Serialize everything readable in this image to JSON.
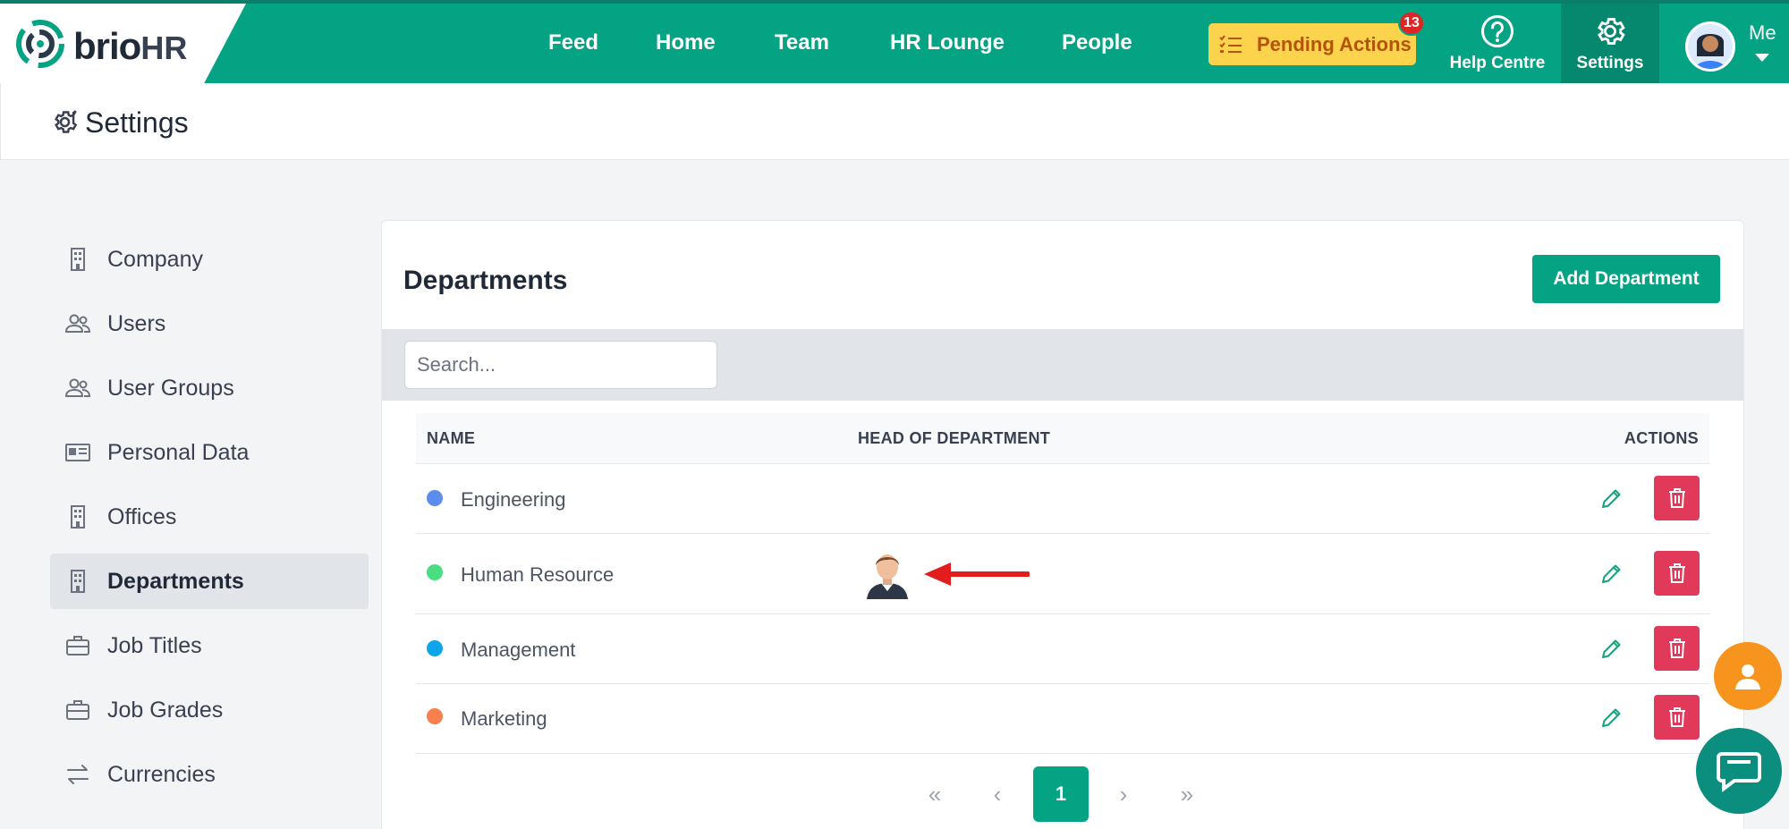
{
  "brand": {
    "name_prefix": "brio",
    "name_suffix": "HR"
  },
  "nav": {
    "items": [
      {
        "label": "Feed"
      },
      {
        "label": "Home"
      },
      {
        "label": "Team"
      },
      {
        "label": "HR Lounge"
      },
      {
        "label": "People"
      }
    ],
    "pending_label": "Pending Actions",
    "pending_count": "13",
    "help_label": "Help Centre",
    "settings_label": "Settings",
    "user_label": "Me"
  },
  "page": {
    "title": "Settings"
  },
  "sidebar": {
    "items": [
      {
        "label": "Company",
        "icon": "building-icon"
      },
      {
        "label": "Users",
        "icon": "users-icon"
      },
      {
        "label": "User Groups",
        "icon": "users-icon"
      },
      {
        "label": "Personal Data",
        "icon": "id-card-icon"
      },
      {
        "label": "Offices",
        "icon": "building-icon"
      },
      {
        "label": "Departments",
        "icon": "building-icon",
        "active": true
      },
      {
        "label": "Job Titles",
        "icon": "briefcase-icon"
      },
      {
        "label": "Job Grades",
        "icon": "briefcase-icon"
      },
      {
        "label": "Currencies",
        "icon": "swap-arrows-icon"
      }
    ]
  },
  "departments": {
    "title": "Departments",
    "add_label": "Add Department",
    "search_placeholder": "Search...",
    "columns": {
      "name": "NAME",
      "head": "HEAD OF DEPARTMENT",
      "actions": "ACTIONS"
    },
    "rows": [
      {
        "name": "Engineering",
        "color": "#5b8def",
        "has_head": false
      },
      {
        "name": "Human Resource",
        "color": "#4ade80",
        "has_head": true
      },
      {
        "name": "Management",
        "color": "#0ea5e9",
        "has_head": false
      },
      {
        "name": "Marketing",
        "color": "#f97f4e",
        "has_head": false
      }
    ]
  },
  "pagination": {
    "current": "1",
    "first": "«",
    "prev": "‹",
    "next": "›",
    "last": "»"
  },
  "colors": {
    "brand": "#04a383",
    "danger": "#e0395a",
    "pending": "#fcd34d"
  }
}
